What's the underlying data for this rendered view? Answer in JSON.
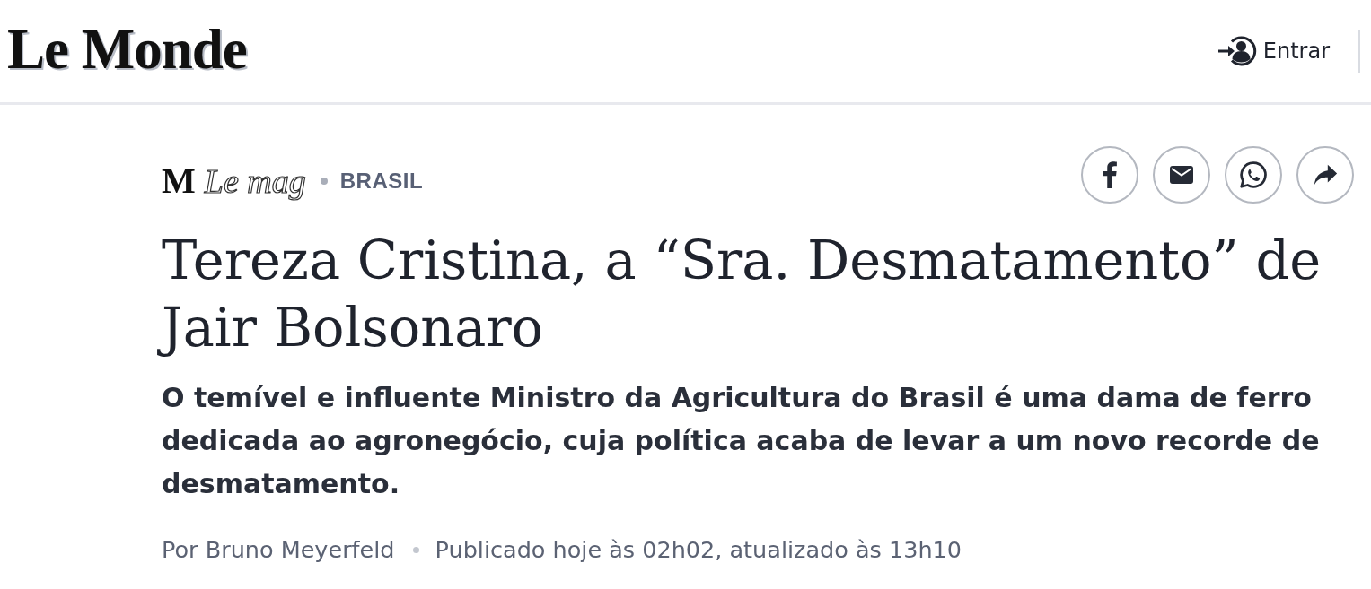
{
  "header": {
    "logo": "Le Monde",
    "login": {
      "label": "Entrar"
    }
  },
  "article": {
    "kicker": {
      "brand_mark": "M",
      "brand": "Le mag",
      "section": "BRASIL"
    },
    "share_buttons": [
      {
        "kind": "facebook"
      },
      {
        "kind": "email"
      },
      {
        "kind": "whatsapp"
      },
      {
        "kind": "share"
      }
    ],
    "title": "Tereza Cristina, a “Sra. Desmatamento” de Jair Bolsonaro",
    "subtitle": "O temível e influente Ministro da Agricultura do Brasil é uma dama de ferro dedicada ao agronegócio, cuja política acaba de levar a um novo recorde de desmatamento.",
    "byline": {
      "author": "Por Bruno Meyerfeld",
      "published": "Publicado hoje às 02h02, atualizado às 13h10"
    }
  }
}
